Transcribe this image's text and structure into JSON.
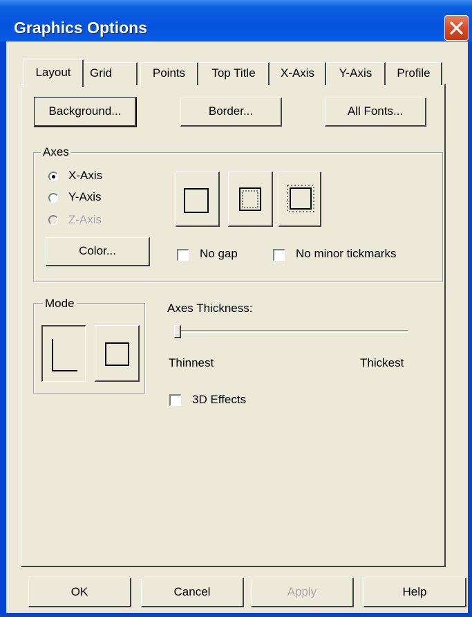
{
  "window": {
    "title": "Graphics Options"
  },
  "tabs": [
    {
      "label": "Layout",
      "active": true
    },
    {
      "label": "Grid"
    },
    {
      "label": "Points"
    },
    {
      "label": "Top Title"
    },
    {
      "label": "X-Axis"
    },
    {
      "label": "Y-Axis"
    },
    {
      "label": "Profile"
    }
  ],
  "top_buttons": {
    "background": "Background...",
    "border": "Border...",
    "all_fonts": "All Fonts..."
  },
  "axes_group": {
    "label": "Axes",
    "radios": [
      {
        "label": "X-Axis",
        "checked": true
      },
      {
        "label": "Y-Axis"
      },
      {
        "label": "Z-Axis",
        "disabled": true
      }
    ],
    "color_button": "Color...",
    "no_gap": "No gap",
    "no_minor_tickmarks": "No minor tickmarks"
  },
  "mode_group": {
    "label": "Mode"
  },
  "thickness": {
    "label": "Axes Thickness:",
    "min_label": "Thinnest",
    "max_label": "Thickest",
    "value": 0
  },
  "effects": {
    "label": "3D Effects"
  },
  "footer": {
    "ok": "OK",
    "cancel": "Cancel",
    "apply": "Apply",
    "help": "Help"
  }
}
